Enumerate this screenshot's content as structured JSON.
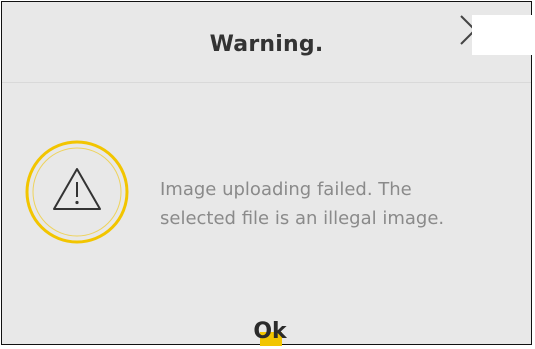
{
  "dialog": {
    "title": "Warning.",
    "message_line1": "Image uploading failed. The",
    "message_line2": "selected file is an illegal image.",
    "ok_label": "Ok",
    "icons": {
      "close": "close-icon",
      "warning": "warning-icon"
    },
    "colors": {
      "background": "#e8e8e8",
      "accent": "#f2c500",
      "title": "#333333",
      "message": "#8a8a8a"
    }
  }
}
